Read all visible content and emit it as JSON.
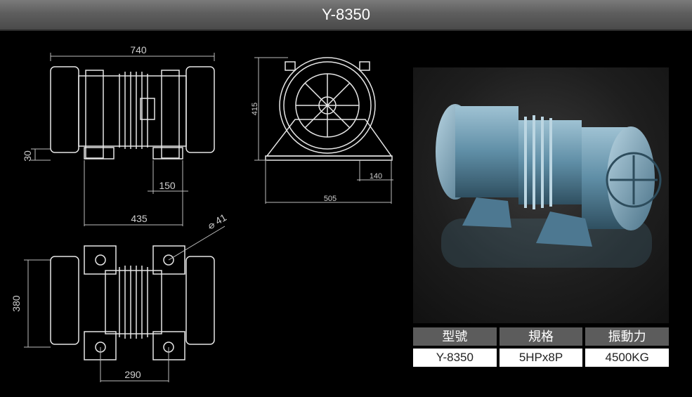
{
  "header": {
    "title": "Y-8350"
  },
  "drawing": {
    "dims": {
      "length": "740",
      "width": "380",
      "height": "415",
      "depth": "505",
      "foot": "140",
      "base_thickness": "30",
      "foot_offset": "150",
      "hole_span_side": "435",
      "hole_span_bottom": "290",
      "hole_dia": "41"
    }
  },
  "specs": {
    "headers": [
      "型號",
      "規格",
      "振動力"
    ],
    "values": [
      "Y-8350",
      "5HPx8P",
      "4500KG"
    ]
  }
}
